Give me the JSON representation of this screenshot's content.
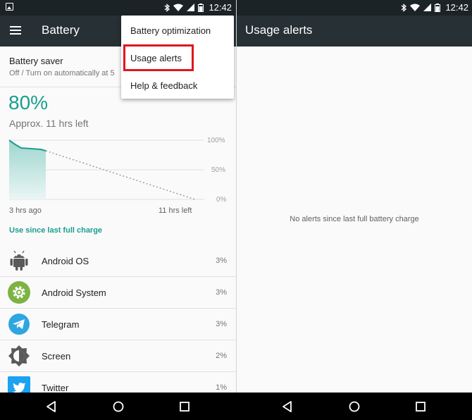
{
  "status_bar": {
    "time": "12:42"
  },
  "left": {
    "toolbar_title": "Battery",
    "battery_saver": {
      "title": "Battery saver",
      "subtitle": "Off / Turn on automatically at 5"
    },
    "battery_percent": "80%",
    "time_left": "Approx. 11 hrs left",
    "chart_labels": {
      "y_100": "100%",
      "y_50": "50%",
      "y_0": "0%",
      "start": "3 hrs ago",
      "end": "11 hrs left"
    },
    "section_header": "Use since last full charge",
    "apps": [
      {
        "name": "Android OS",
        "percent": "3%",
        "icon": "android-icon"
      },
      {
        "name": "Android System",
        "percent": "3%",
        "icon": "settings-gear-icon"
      },
      {
        "name": "Telegram",
        "percent": "3%",
        "icon": "telegram-icon"
      },
      {
        "name": "Screen",
        "percent": "2%",
        "icon": "brightness-icon"
      },
      {
        "name": "Twitter",
        "percent": "1%",
        "icon": "twitter-icon"
      }
    ],
    "menu": {
      "items": [
        "Battery optimization",
        "Usage alerts",
        "Help & feedback"
      ],
      "highlighted": "Usage alerts"
    }
  },
  "right": {
    "toolbar_title": "Usage alerts",
    "empty_message": "No alerts since last full battery charge"
  },
  "colors": {
    "accent": "#1a9e8f",
    "toolbar": "#263035",
    "statusbar": "#1c2326",
    "highlight": "#e0161e"
  }
}
